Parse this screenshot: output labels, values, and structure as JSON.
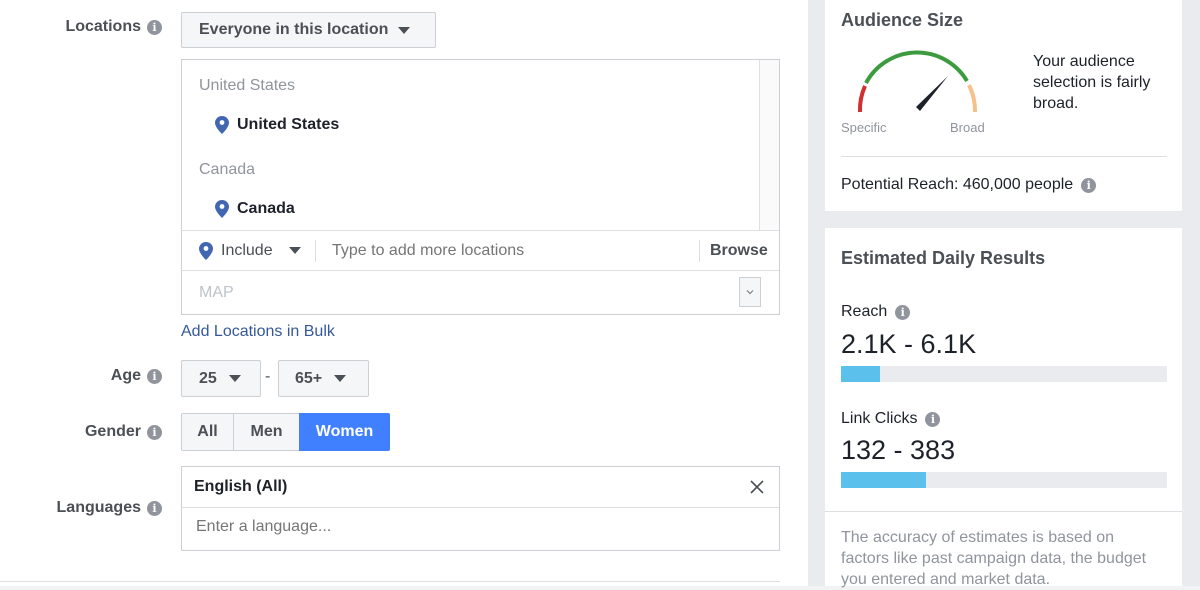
{
  "locations": {
    "label": "Locations",
    "audience_dropdown": "Everyone in this location",
    "groups": [
      {
        "header": "United States",
        "item": "United States"
      },
      {
        "header": "Canada",
        "item": "Canada"
      }
    ],
    "include_label": "Include",
    "add_placeholder": "Type to add more locations",
    "browse_label": "Browse",
    "map_label": "MAP",
    "bulk_link": "Add Locations in Bulk"
  },
  "age": {
    "label": "Age",
    "min": "25",
    "separator": "-",
    "max": "65+"
  },
  "gender": {
    "label": "Gender",
    "options": [
      "All",
      "Men",
      "Women"
    ],
    "selected": "Women"
  },
  "languages": {
    "label": "Languages",
    "selected_tag": "English (All)",
    "placeholder": "Enter a language..."
  },
  "audience_size": {
    "title": "Audience Size",
    "gauge_left": "Specific",
    "gauge_right": "Broad",
    "description": "Your audience selection is fairly broad.",
    "potential_reach": "Potential Reach: 460,000 people"
  },
  "daily_results": {
    "title": "Estimated Daily Results",
    "reach_label": "Reach",
    "reach_value": "2.1K - 6.1K",
    "reach_fill": 0.12,
    "clicks_label": "Link Clicks",
    "clicks_value": "132 - 383",
    "clicks_fill": 0.26,
    "footnote": "The accuracy of estimates is based on factors like past campaign data, the budget you entered and market data."
  },
  "colors": {
    "accent": "#4080ff",
    "bar": "#5bc0eb",
    "link": "#365899",
    "pin": "#4267b2"
  }
}
